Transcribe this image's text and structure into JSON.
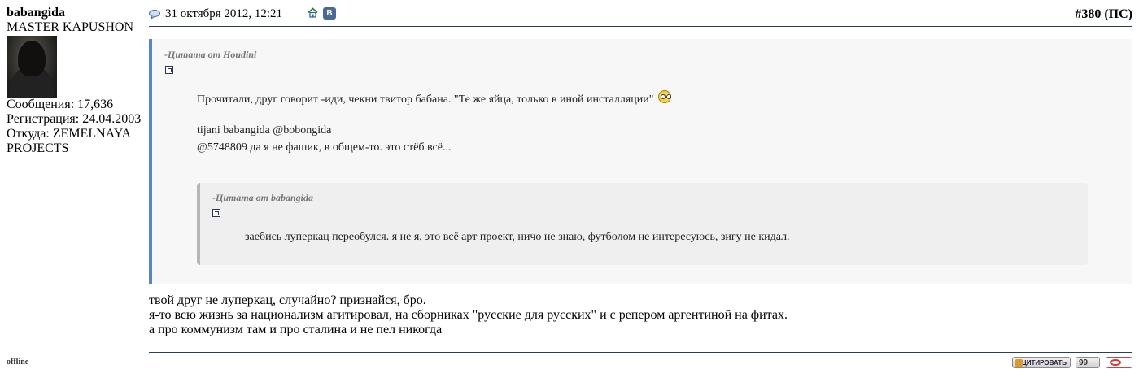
{
  "user": {
    "name": "babangida",
    "title": "MASTER KAPUSHON",
    "posts": "Сообщения: 17,636",
    "registered": "Регистрация: 24.04.2003",
    "location_line1": "Откуда: ZEMELNAYA",
    "location_line2": "PROJECTS",
    "status": "offline"
  },
  "post": {
    "date": "31 октября 2012, 12:21",
    "number": "#380 (ПС)",
    "vk_label": "В",
    "quote": {
      "author": "-Цитата от Houdini",
      "line1": "Прочитали, друг говорит -иди, чекни твитор бабана. \"Те же яйца, только в иной инсталляции\"",
      "line2": "tijani babangida @bobongida",
      "line3": "@5748809 да я не фашик, в общем-то. это стёб всё...",
      "nested": {
        "author": "-Цитата от babangida",
        "text": "заебись луперкац переобулся. я не я, это всё арт проект, ничо не знаю, футболом не интересуюсь, зигу не кидал."
      }
    },
    "body": {
      "line1": "твой друг не луперкац, случайно? признайся, бро.",
      "line2": "я-то всю жизнь за национализм агитировал, на сборниках \"русские для русских\" и с репером аргентиной на фитах.",
      "line3": "а про коммунизм там и про сталина и не пел никогда"
    }
  },
  "buttons": {
    "quote_label": "ЦИТИРОВАТЬ",
    "multiquote_label": "99"
  },
  "icons": {
    "date": "speech-bubble-icon",
    "home": "home-icon",
    "vk": "vk-icon",
    "quote_link": "view-post-icon",
    "smiley": "smiley-icon",
    "report": "report-icon"
  }
}
